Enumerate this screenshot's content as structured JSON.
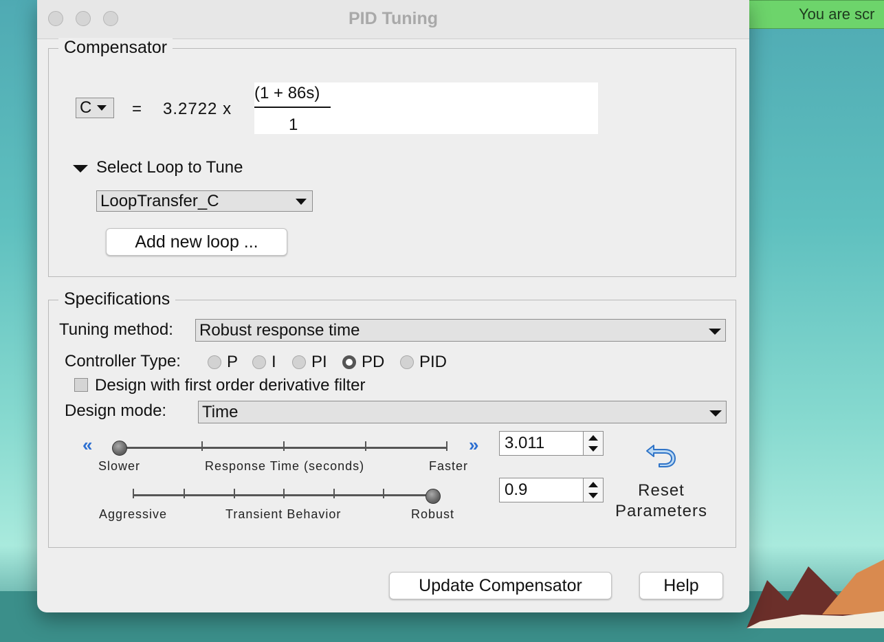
{
  "window": {
    "title": "PID Tuning"
  },
  "notification": {
    "text": "You are scr",
    "color": "#6dd46b"
  },
  "compensator": {
    "legend": "Compensator",
    "variable": "C",
    "equals": "=",
    "gain": "3.2722 x",
    "numerator": "(1 + 86s)",
    "denominator": "1",
    "select_loop_label": "Select Loop to Tune",
    "loop_value": "LoopTransfer_C",
    "add_loop_label": "Add new loop ..."
  },
  "specifications": {
    "legend": "Specifications",
    "tuning_method_label": "Tuning method:",
    "tuning_method_value": "Robust response time",
    "controller_type_label": "Controller Type:",
    "controller_types": [
      {
        "label": "P",
        "selected": false
      },
      {
        "label": "I",
        "selected": false
      },
      {
        "label": "PI",
        "selected": false
      },
      {
        "label": "PD",
        "selected": true
      },
      {
        "label": "PID",
        "selected": false
      }
    ],
    "derivative_filter_label": "Design with first order derivative filter",
    "derivative_filter_checked": false,
    "design_mode_label": "Design mode:",
    "design_mode_value": "Time",
    "response_slider": {
      "left_label": "Slower",
      "center_label": "Response Time (seconds)",
      "right_label": "Faster",
      "value": "3.011",
      "position_fraction": 0.0
    },
    "transient_slider": {
      "left_label": "Aggressive",
      "center_label": "Transient Behavior",
      "right_label": "Robust",
      "value": "0.9",
      "position_fraction": 1.0
    },
    "reset_label_line1": "Reset",
    "reset_label_line2": "Parameters"
  },
  "buttons": {
    "update": "Update Compensator",
    "help": "Help"
  },
  "colors": {
    "accent_arrow": "#2c6fd1",
    "window_bg": "#eeeeee"
  }
}
